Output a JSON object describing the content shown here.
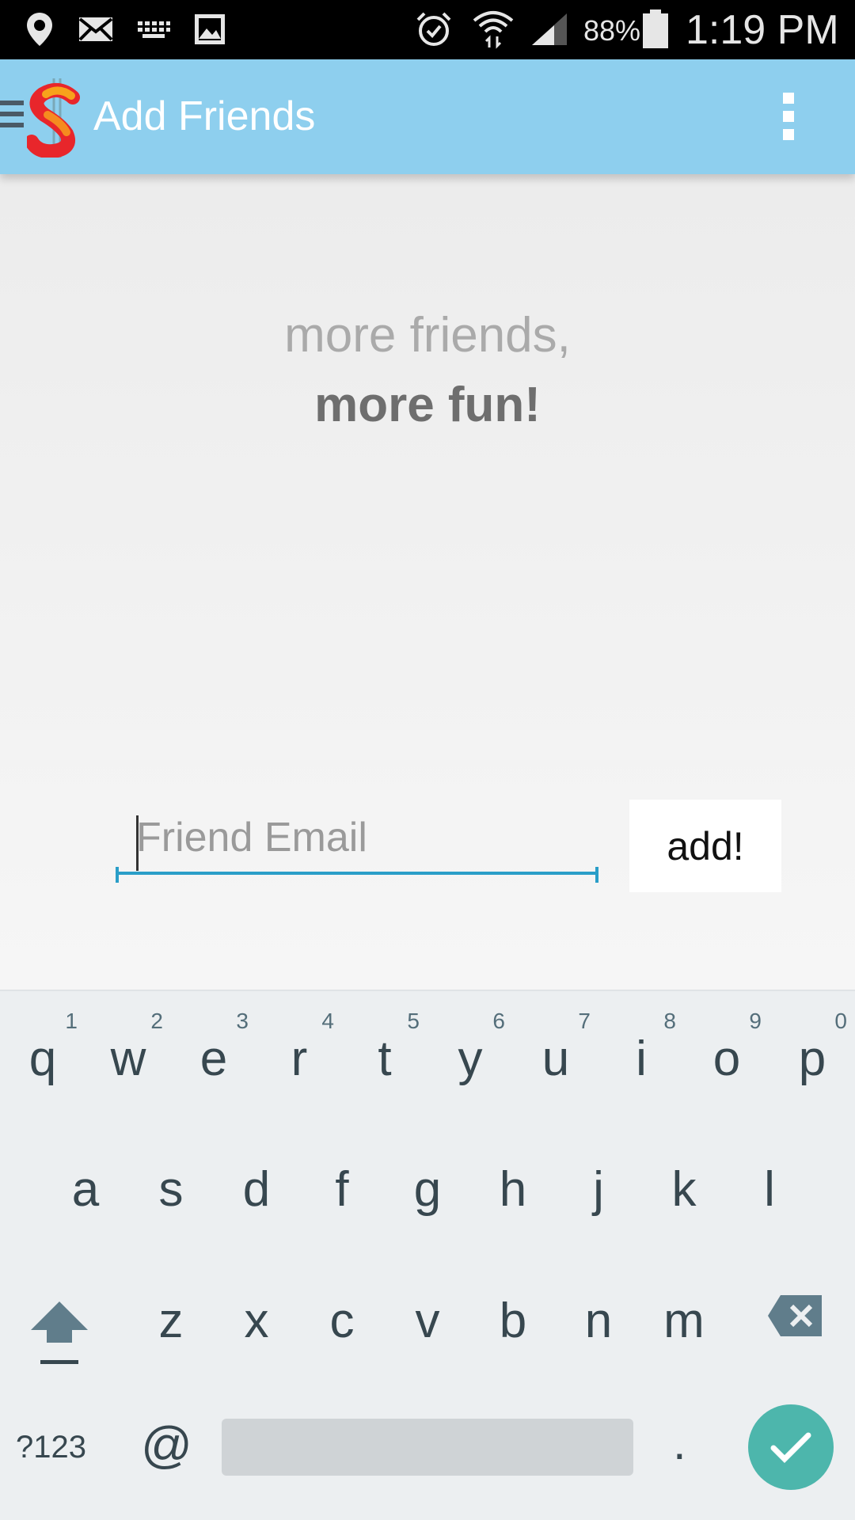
{
  "status_bar": {
    "battery_percent": "88%",
    "time": "1:19 PM",
    "icons": [
      "location-pin-icon",
      "mail-icon",
      "keyboard-icon",
      "image-icon",
      "alarm-icon",
      "wifi-icon",
      "signal-icon",
      "battery-icon"
    ]
  },
  "app_bar": {
    "title": "Add Friends",
    "logo": "dollar-s-logo",
    "menu_icon": "hamburger-menu-icon",
    "overflow_icon": "overflow-menu-icon"
  },
  "content": {
    "tagline_line1": "more friends,",
    "tagline_line2": "more fun!",
    "email_input": {
      "placeholder": "Friend Email",
      "value": ""
    },
    "add_button_label": "add!"
  },
  "keyboard": {
    "row1": [
      {
        "key": "q",
        "hint": "1"
      },
      {
        "key": "w",
        "hint": "2"
      },
      {
        "key": "e",
        "hint": "3"
      },
      {
        "key": "r",
        "hint": "4"
      },
      {
        "key": "t",
        "hint": "5"
      },
      {
        "key": "y",
        "hint": "6"
      },
      {
        "key": "u",
        "hint": "7"
      },
      {
        "key": "i",
        "hint": "8"
      },
      {
        "key": "o",
        "hint": "9"
      },
      {
        "key": "p",
        "hint": "0"
      }
    ],
    "row2": [
      "a",
      "s",
      "d",
      "f",
      "g",
      "h",
      "j",
      "k",
      "l"
    ],
    "row3": [
      "z",
      "x",
      "c",
      "v",
      "b",
      "n",
      "m"
    ],
    "symbols_label": "?123",
    "at_label": "@",
    "period_label": ".",
    "colors": {
      "enter": "#4db6ac",
      "background": "#eceff1"
    }
  },
  "colors": {
    "app_bar": "#8ecfee",
    "input_underline": "#2a9ec8"
  }
}
